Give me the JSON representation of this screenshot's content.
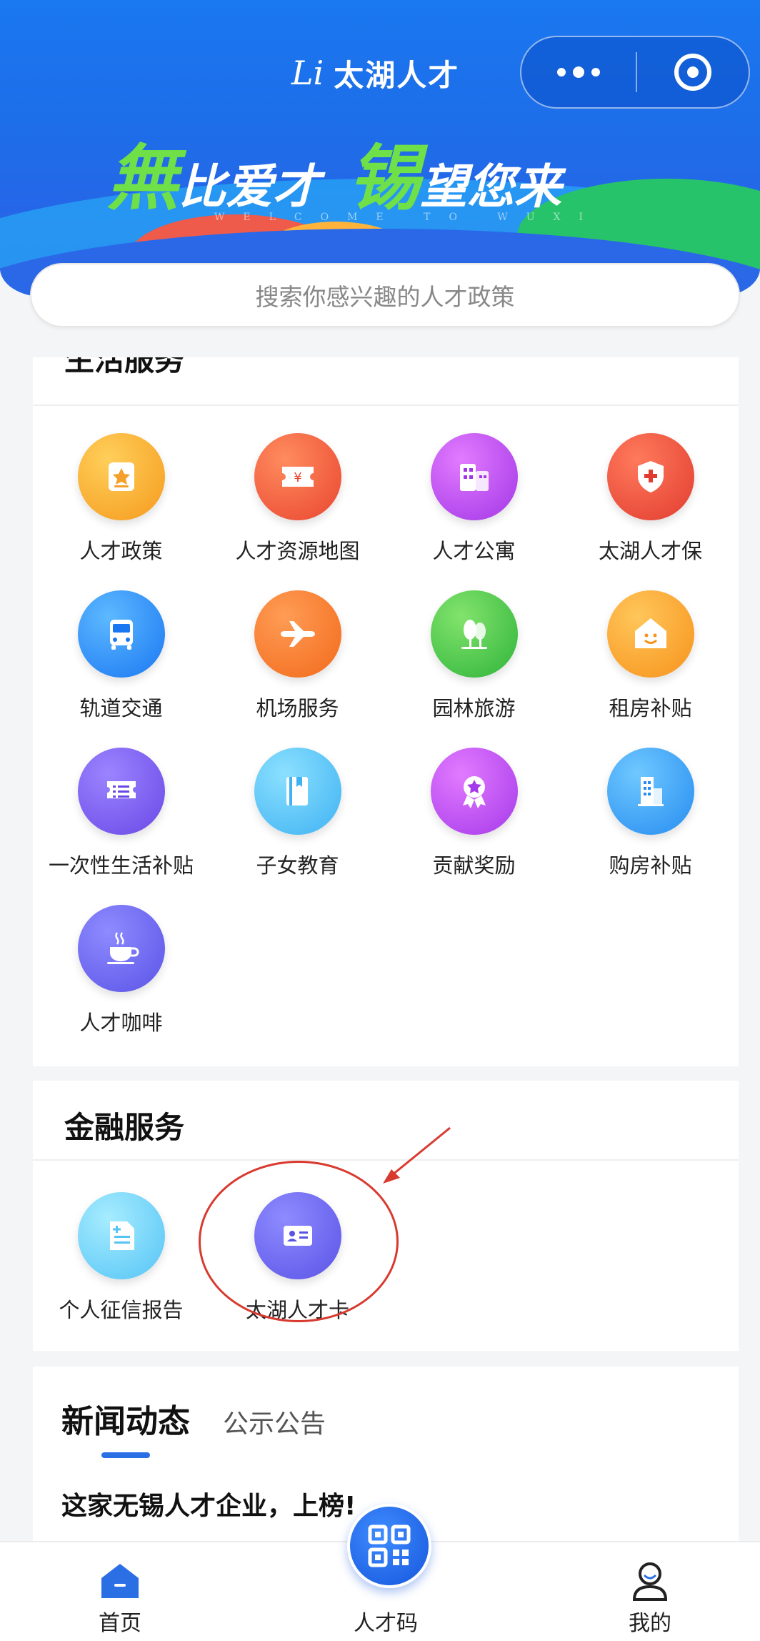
{
  "header": {
    "app_title": "太湖人才",
    "logo_text": "Li",
    "slogan_1": "無",
    "slogan_2": "比爱才",
    "slogan_3": "锡",
    "slogan_4": "望您来",
    "welcome": "WELCOME TO WUXI"
  },
  "search": {
    "placeholder": "搜索你感兴趣的人才政策"
  },
  "life": {
    "title": "生活服务",
    "items": [
      {
        "label": "人才政策",
        "icon": "policy-icon"
      },
      {
        "label": "人才资源地图",
        "icon": "ticket-icon"
      },
      {
        "label": "人才公寓",
        "icon": "building-icon"
      },
      {
        "label": "太湖人才保",
        "icon": "shield-icon"
      },
      {
        "label": "轨道交通",
        "icon": "bus-icon"
      },
      {
        "label": "机场服务",
        "icon": "plane-icon"
      },
      {
        "label": "园林旅游",
        "icon": "tree-icon"
      },
      {
        "label": "租房补贴",
        "icon": "house-icon"
      },
      {
        "label": "一次性生活补贴",
        "icon": "list-icon"
      },
      {
        "label": "子女教育",
        "icon": "book-icon"
      },
      {
        "label": "贡献奖励",
        "icon": "medal-icon"
      },
      {
        "label": "购房补贴",
        "icon": "office-icon"
      },
      {
        "label": "人才咖啡",
        "icon": "coffee-icon"
      }
    ]
  },
  "finance": {
    "title": "金融服务",
    "items": [
      {
        "label": "个人征信报告",
        "icon": "report-icon"
      },
      {
        "label": "太湖人才卡",
        "icon": "id-card-icon"
      }
    ]
  },
  "news": {
    "tab_active": "新闻动态",
    "tab_inactive": "公示公告",
    "headline": "这家无锡人才企业，上榜!"
  },
  "nav": {
    "home": "首页",
    "qr": "人才码",
    "mine": "我的"
  },
  "colors": {
    "brand_blue": "#1d6ee9",
    "accent_green": "#6fe048",
    "annotation_red": "#d93a2f"
  }
}
